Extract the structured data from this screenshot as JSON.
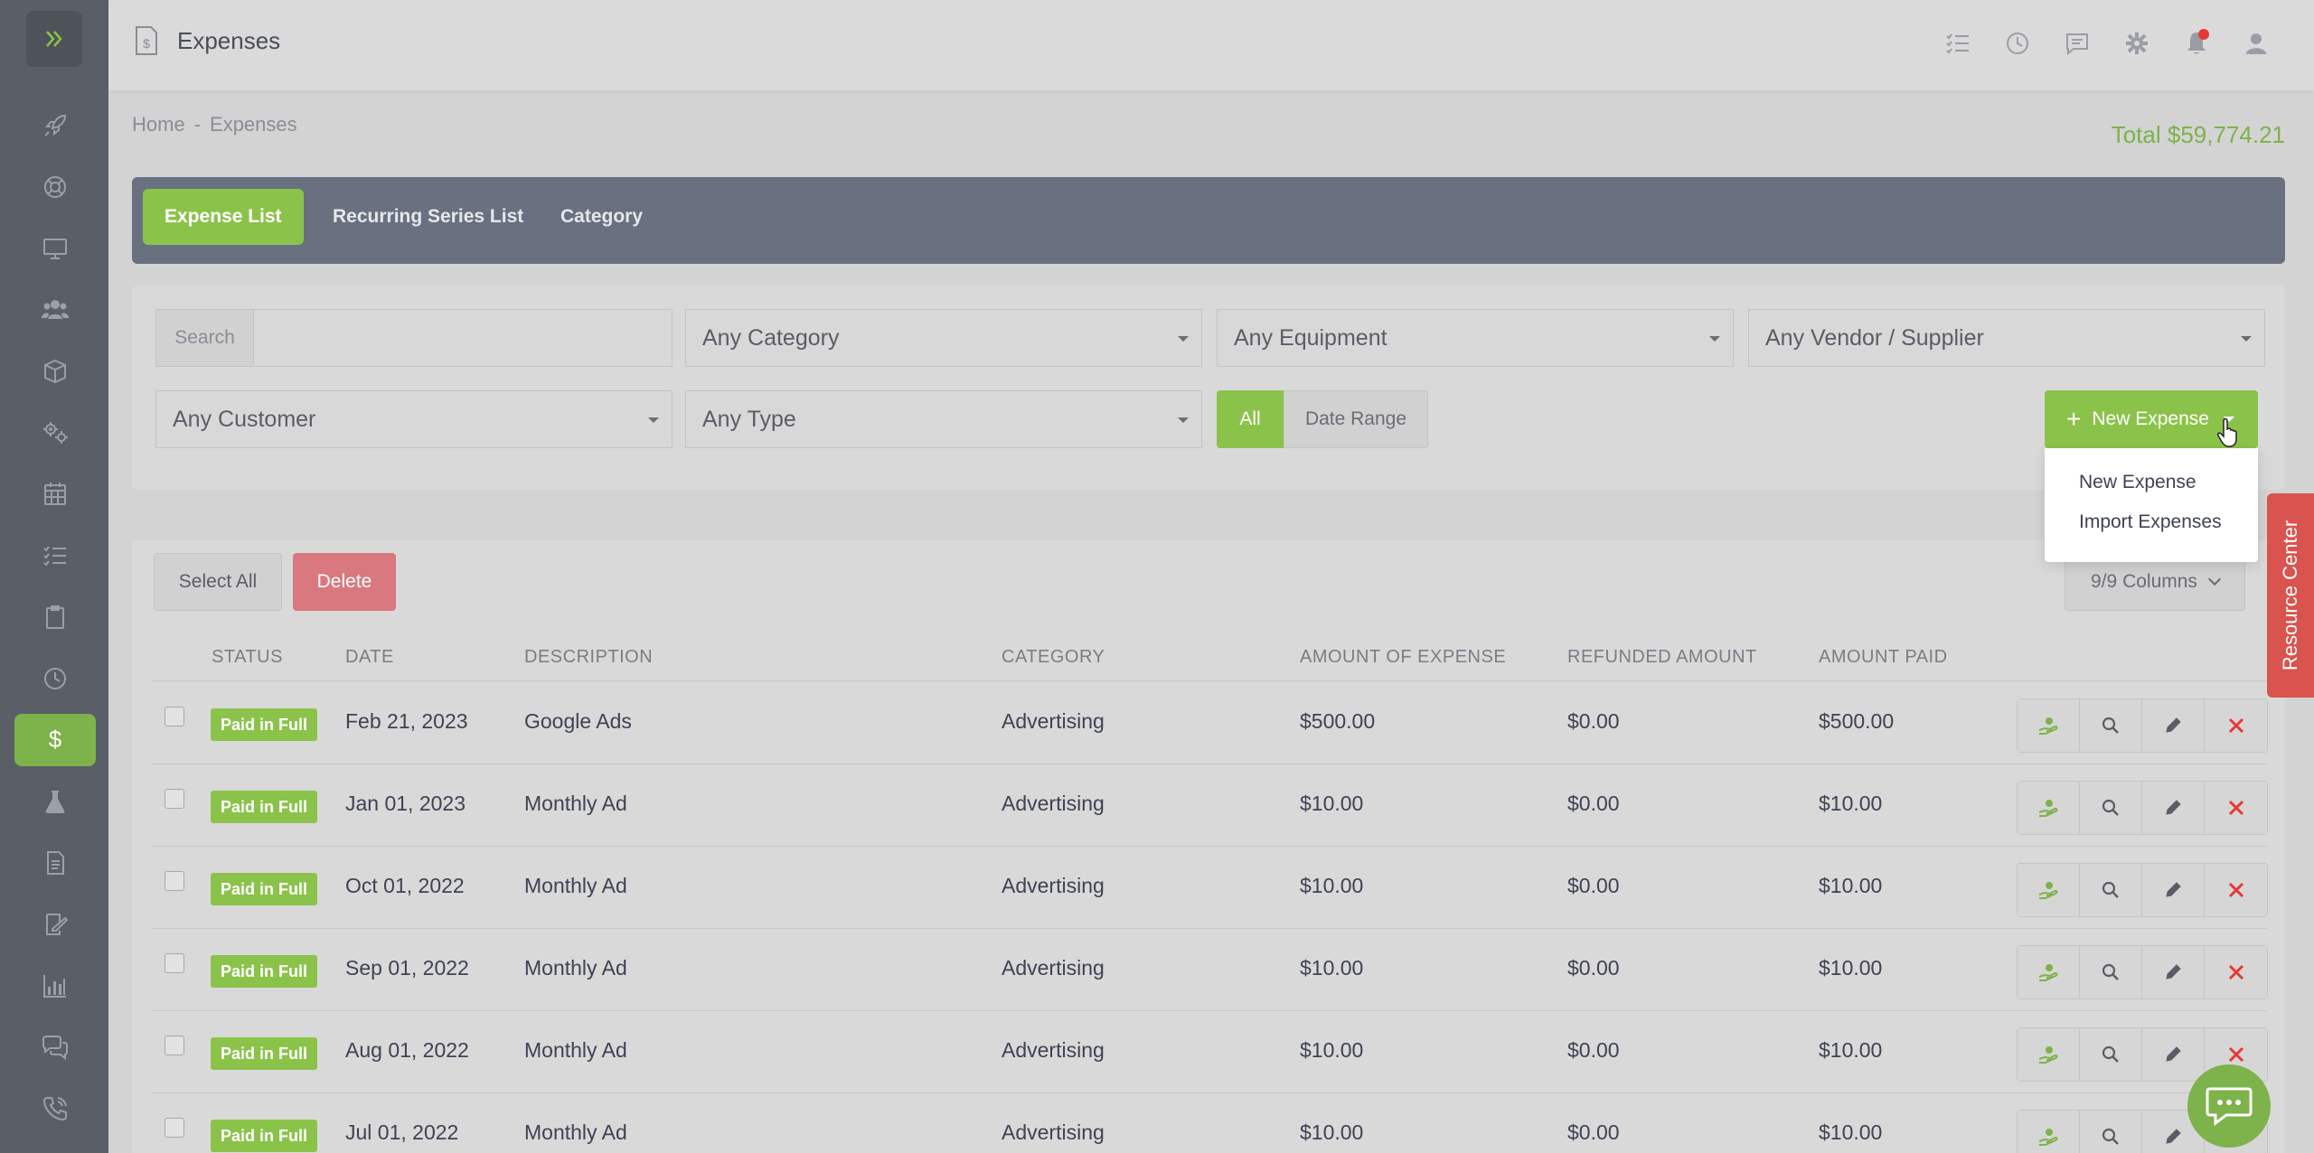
{
  "header": {
    "title": "Expenses"
  },
  "breadcrumb": {
    "home": "Home",
    "sep": "-",
    "current": "Expenses"
  },
  "total": "Total $59,774.21",
  "tabs": [
    "Expense List",
    "Recurring Series List",
    "Category"
  ],
  "filters": {
    "search_label": "Search",
    "search_value": "",
    "category": "Any Category",
    "equipment": "Any Equipment",
    "vendor": "Any Vendor / Supplier",
    "customer": "Any Customer",
    "type": "Any Type",
    "all": "All",
    "date_range": "Date Range"
  },
  "new_expense": {
    "label": "New Expense",
    "menu": [
      "New Expense",
      "Import Expenses"
    ]
  },
  "table": {
    "select_all": "Select All",
    "delete": "Delete",
    "columns": "9/9 Columns",
    "headers": [
      "STATUS",
      "DATE",
      "DESCRIPTION",
      "CATEGORY",
      "AMOUNT OF EXPENSE",
      "REFUNDED AMOUNT",
      "AMOUNT PAID"
    ],
    "rows": [
      {
        "status": "Paid in Full",
        "date": "Feb 21, 2023",
        "description": "Google Ads",
        "category": "Advertising",
        "amount": "$500.00",
        "refunded": "$0.00",
        "paid": "$500.00"
      },
      {
        "status": "Paid in Full",
        "date": "Jan 01, 2023",
        "description": "Monthly Ad",
        "category": "Advertising",
        "amount": "$10.00",
        "refunded": "$0.00",
        "paid": "$10.00"
      },
      {
        "status": "Paid in Full",
        "date": "Oct 01, 2022",
        "description": "Monthly Ad",
        "category": "Advertising",
        "amount": "$10.00",
        "refunded": "$0.00",
        "paid": "$10.00"
      },
      {
        "status": "Paid in Full",
        "date": "Sep 01, 2022",
        "description": "Monthly Ad",
        "category": "Advertising",
        "amount": "$10.00",
        "refunded": "$0.00",
        "paid": "$10.00"
      },
      {
        "status": "Paid in Full",
        "date": "Aug 01, 2022",
        "description": "Monthly Ad",
        "category": "Advertising",
        "amount": "$10.00",
        "refunded": "$0.00",
        "paid": "$10.00"
      },
      {
        "status": "Paid in Full",
        "date": "Jul 01, 2022",
        "description": "Monthly Ad",
        "category": "Advertising",
        "amount": "$10.00",
        "refunded": "$0.00",
        "paid": "$10.00"
      }
    ]
  },
  "resource_center": "Resource Center",
  "colors": {
    "accent": "#8bc34a",
    "danger": "#e53935",
    "sidebar": "#5a5e66",
    "tabbar": "#697180"
  }
}
